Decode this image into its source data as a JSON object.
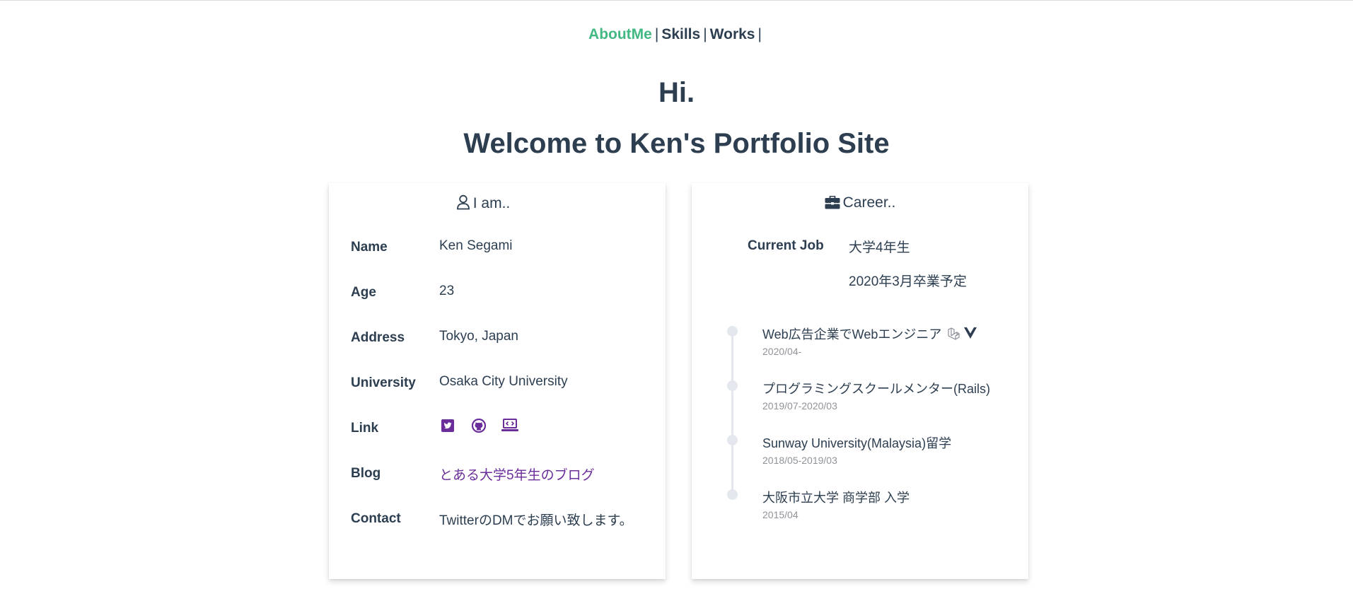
{
  "nav": {
    "items": [
      {
        "label": "AboutMe",
        "active": true
      },
      {
        "label": "Skills",
        "active": false
      },
      {
        "label": "Works",
        "active": false
      }
    ],
    "separator": "|",
    "accent_color": "#42b983"
  },
  "hero": {
    "line1": "Hi.",
    "line2": "Welcome to Ken's Portfolio Site"
  },
  "about": {
    "title": "I am..",
    "title_icon": "user-icon",
    "rows": {
      "name": {
        "label": "Name",
        "value": "Ken Segami"
      },
      "age": {
        "label": "Age",
        "value": "23"
      },
      "address": {
        "label": "Address",
        "value": "Tokyo, Japan"
      },
      "university": {
        "label": "University",
        "value": "Osaka City University"
      },
      "link": {
        "label": "Link",
        "icons": [
          "twitter-icon",
          "github-icon",
          "laptop-code-icon"
        ]
      },
      "blog": {
        "label": "Blog",
        "value": "とある大学5年生のブログ"
      },
      "contact": {
        "label": "Contact",
        "value": "TwitterのDMでお願い致します。"
      }
    },
    "link_color": "#6a2d9a"
  },
  "career": {
    "title": "Career..",
    "title_icon": "briefcase-icon",
    "current_job": {
      "label": "Current Job",
      "value1": "大学4年生",
      "value2": "2020年3月卒業予定"
    },
    "timeline": [
      {
        "text": "Web広告企業でWebエンジニア",
        "date": "2020/04-",
        "icons": [
          "laravel-icon",
          "vue-icon"
        ]
      },
      {
        "text": "プログラミングスクールメンター(Rails)",
        "date": "2019/07-2020/03"
      },
      {
        "text": "Sunway University(Malaysia)留学",
        "date": "2018/05-2019/03"
      },
      {
        "text": "大阪市立大学 商学部 入学",
        "date": "2015/04"
      }
    ]
  }
}
